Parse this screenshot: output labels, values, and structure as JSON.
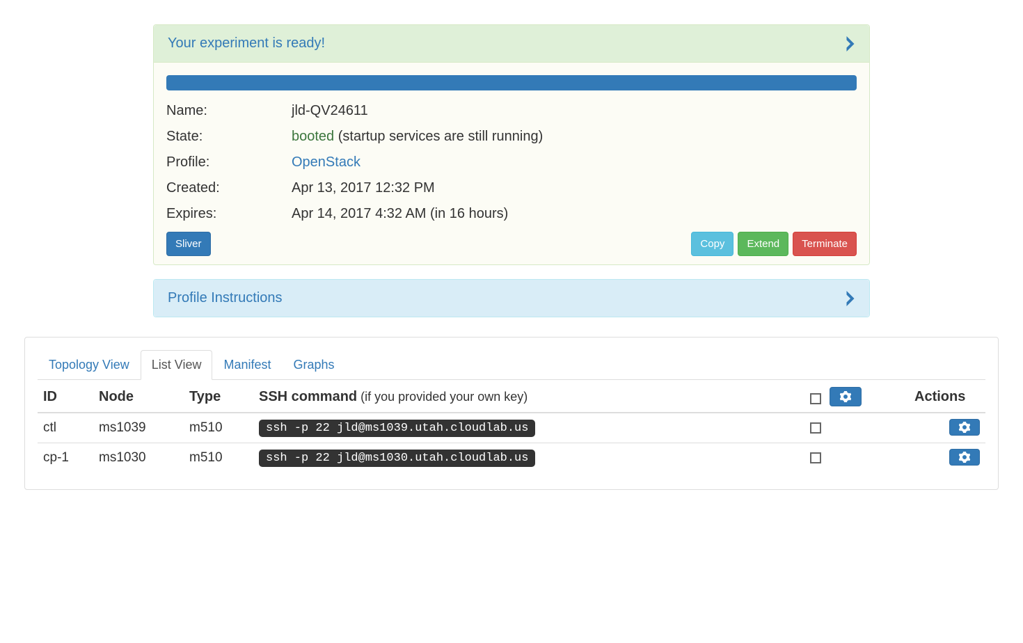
{
  "ready_panel": {
    "title": "Your experiment is ready!"
  },
  "info": {
    "name_label": "Name:",
    "name_value": "jld-QV24611",
    "state_label": "State:",
    "state_value": "booted",
    "state_suffix": " (startup services are still running)",
    "profile_label": "Profile:",
    "profile_value": "OpenStack",
    "created_label": "Created:",
    "created_value": "Apr 13, 2017 12:32 PM",
    "expires_label": "Expires:",
    "expires_value": "Apr 14, 2017 4:32 AM (in 16 hours)"
  },
  "buttons": {
    "sliver": "Sliver",
    "copy": "Copy",
    "extend": "Extend",
    "terminate": "Terminate"
  },
  "instructions_panel": {
    "title": "Profile Instructions"
  },
  "tabs": {
    "topology": "Topology View",
    "list": "List View",
    "manifest": "Manifest",
    "graphs": "Graphs"
  },
  "table": {
    "headers": {
      "id": "ID",
      "node": "Node",
      "type": "Type",
      "ssh": "SSH command",
      "ssh_note": " (if you provided your own key)",
      "actions": "Actions"
    },
    "rows": [
      {
        "id": "ctl",
        "node": "ms1039",
        "type": "m510",
        "ssh": "ssh -p 22 jld@ms1039.utah.cloudlab.us"
      },
      {
        "id": "cp-1",
        "node": "ms1030",
        "type": "m510",
        "ssh": "ssh -p 22 jld@ms1030.utah.cloudlab.us"
      }
    ]
  }
}
